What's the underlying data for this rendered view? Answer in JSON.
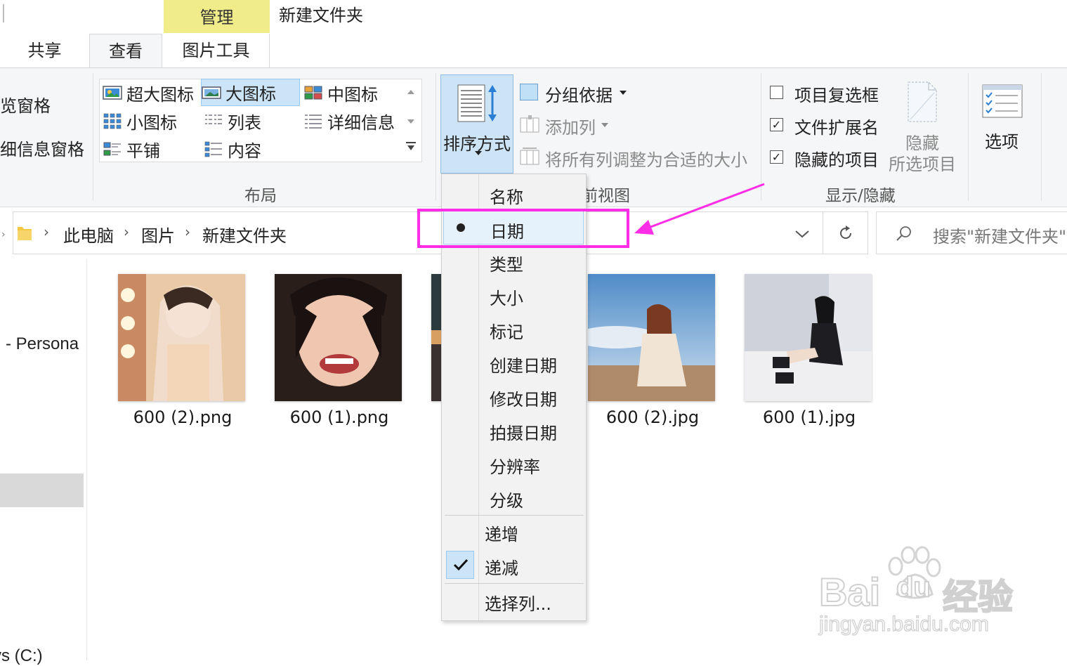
{
  "title_bar": {
    "context_tab": "管理",
    "window_title": "新建文件夹"
  },
  "ribbon_tabs": [
    {
      "label": "共享",
      "active": false
    },
    {
      "label": "查看",
      "active": true
    },
    {
      "label": "图片工具",
      "active": false
    }
  ],
  "ribbon": {
    "panes": {
      "preview_pane": "览窗格",
      "details_pane": "细信息窗格"
    },
    "layout": {
      "items": [
        {
          "label": "超大图标",
          "icon": "extra-large-icons-icon"
        },
        {
          "label": "大图标",
          "icon": "large-icons-icon",
          "selected": true
        },
        {
          "label": "中图标",
          "icon": "medium-icons-icon"
        },
        {
          "label": "小图标",
          "icon": "small-icons-icon"
        },
        {
          "label": "列表",
          "icon": "list-icon"
        },
        {
          "label": "详细信息",
          "icon": "details-icon"
        },
        {
          "label": "平铺",
          "icon": "tiles-icon"
        },
        {
          "label": "内容",
          "icon": "content-icon"
        }
      ],
      "group_label": "布局"
    },
    "current_view": {
      "sort_by_label": "排序方式",
      "group_by_label": "分组依据",
      "add_columns_label": "添加列",
      "size_all_columns_label": "将所有列调整为合适的大小",
      "group_label_fragment": "前视图"
    },
    "show_hide": {
      "item_checkboxes": {
        "label": "项目复选框",
        "checked": false
      },
      "file_extensions": {
        "label": "文件扩展名",
        "checked": true
      },
      "hidden_items": {
        "label": "隐藏的项目",
        "checked": true
      },
      "hide_selected_line1": "隐藏",
      "hide_selected_line2": "所选项目",
      "group_label": "显示/隐藏"
    },
    "options_label": "选项"
  },
  "address_bar": {
    "breadcrumbs": [
      "此电脑",
      "图片",
      "新建文件夹"
    ],
    "search_placeholder": "搜索\"新建文件夹\""
  },
  "nav_pane": {
    "item_personal": "- Persona",
    "item_drive": "vs (C:)"
  },
  "files": [
    {
      "name": "600 (2).png",
      "palette": [
        "#f3d6b8",
        "#c98a63",
        "#e8c7a6"
      ]
    },
    {
      "name": "600 (1).png",
      "palette": [
        "#2a1e1a",
        "#efc6b0",
        "#b23a3a"
      ]
    },
    {
      "name": "",
      "palette": [
        "#2b3a3c",
        "#5a6a5a",
        "#3a3030"
      ]
    },
    {
      "name": "600 (2).jpg",
      "palette": [
        "#6fa0d0",
        "#f2e4d4",
        "#b08b6a"
      ]
    },
    {
      "name": "600 (1).jpg",
      "palette": [
        "#cfd2da",
        "#efeff2",
        "#1e1e22"
      ]
    }
  ],
  "sort_menu": {
    "fields": [
      {
        "label": "名称",
        "checked": false
      },
      {
        "label": "日期",
        "checked": true,
        "highlighted": true
      },
      {
        "label": "类型",
        "checked": false
      },
      {
        "label": "大小",
        "checked": false
      },
      {
        "label": "标记",
        "checked": false
      },
      {
        "label": "创建日期",
        "checked": false
      },
      {
        "label": "修改日期",
        "checked": false
      },
      {
        "label": "拍摄日期",
        "checked": false
      },
      {
        "label": "分辨率",
        "checked": false
      },
      {
        "label": "分级",
        "checked": false
      }
    ],
    "ascending": {
      "label": "递增",
      "checked": false
    },
    "descending": {
      "label": "递减",
      "checked": true
    },
    "choose_columns": "选择列..."
  },
  "annotation": {
    "color": "#ff2ee6"
  },
  "watermark": {
    "line1": "Bai",
    "line2": "du",
    "line3": "经验",
    "url": "jingyan.baidu.com"
  }
}
